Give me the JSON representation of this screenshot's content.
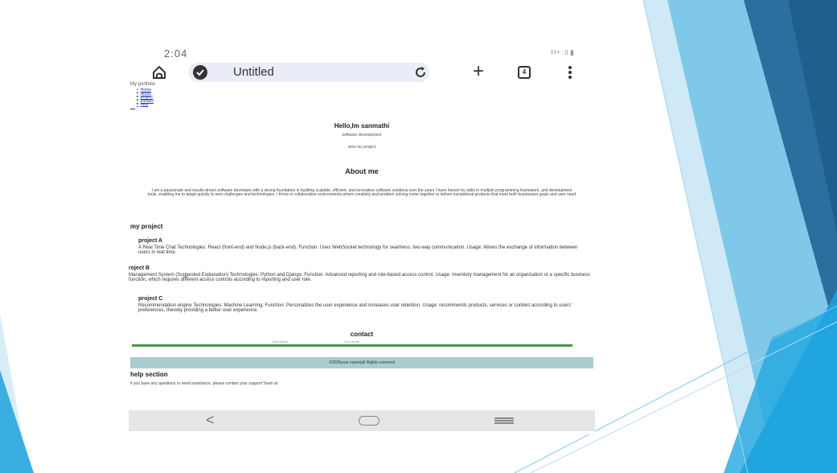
{
  "status_bar": {
    "time": "2:04",
    "signal": "H+ :ıl ▮"
  },
  "browser": {
    "tab_title": "Untitled",
    "tab_count": "4"
  },
  "site": {
    "brand": "My portfolio",
    "nav": [
      "Home",
      "About",
      "project",
      "contact",
      "help"
    ],
    "hero": {
      "title": "Hello,Im sanmathi",
      "subtitle": "software development",
      "cta": "view my project"
    },
    "about": {
      "title": "About me",
      "text": "I am a passionate and results-driven software developer with a strong foundation in building scalable, efficient, and innovative software solutions.over the years I have honed my skills in multiple programming framework, and development tools, enabling me to adapt quickly to new challenges and technologies. I thrive in collaborative environments where creativity and problem solving come together to deliver exceptional products that meet both businesses goals and user need"
    },
    "projects_heading": "my project",
    "projects": [
      {
        "title": "project A",
        "desc": "A Real Time Chat Technologies: React (front-end) and Node.js (back-end). Function: Uses WebSocket technology for seamless, two-way communication. Usage: Allows the exchange of information between users in real time."
      },
      {
        "title": "roject B",
        "desc": "Management System (Suggested Explanation) Technologies: Python and Django. Function: Advanced reporting and role-based access control. Usage: Inventory management for an organization or a specific business function, which requires different access controls according to reporting and user role."
      },
      {
        "title": "project C",
        "desc": "Recommendation engine Technologies: Machine Learning. Function: Personalizes the user experience and increases user retention. Usage: recommends products, services or content according to users' preferences, thereby providing a better user experience."
      }
    ],
    "contact": {
      "title": "contact",
      "name_label": "Your Name",
      "email_label": "Your email",
      "accent": "#3f9a3f"
    },
    "footer": "©2025your name(all Rights reserved",
    "help": {
      "title": "help section",
      "text": "if you have any questions or need assistance, please contact your support Team at"
    }
  },
  "colors": {
    "footer_bg": "#a9cdd0",
    "tab_pill": "#e8edf7",
    "slide_blue": "#1d9bd6",
    "slide_dark": "#2b6f9e"
  }
}
